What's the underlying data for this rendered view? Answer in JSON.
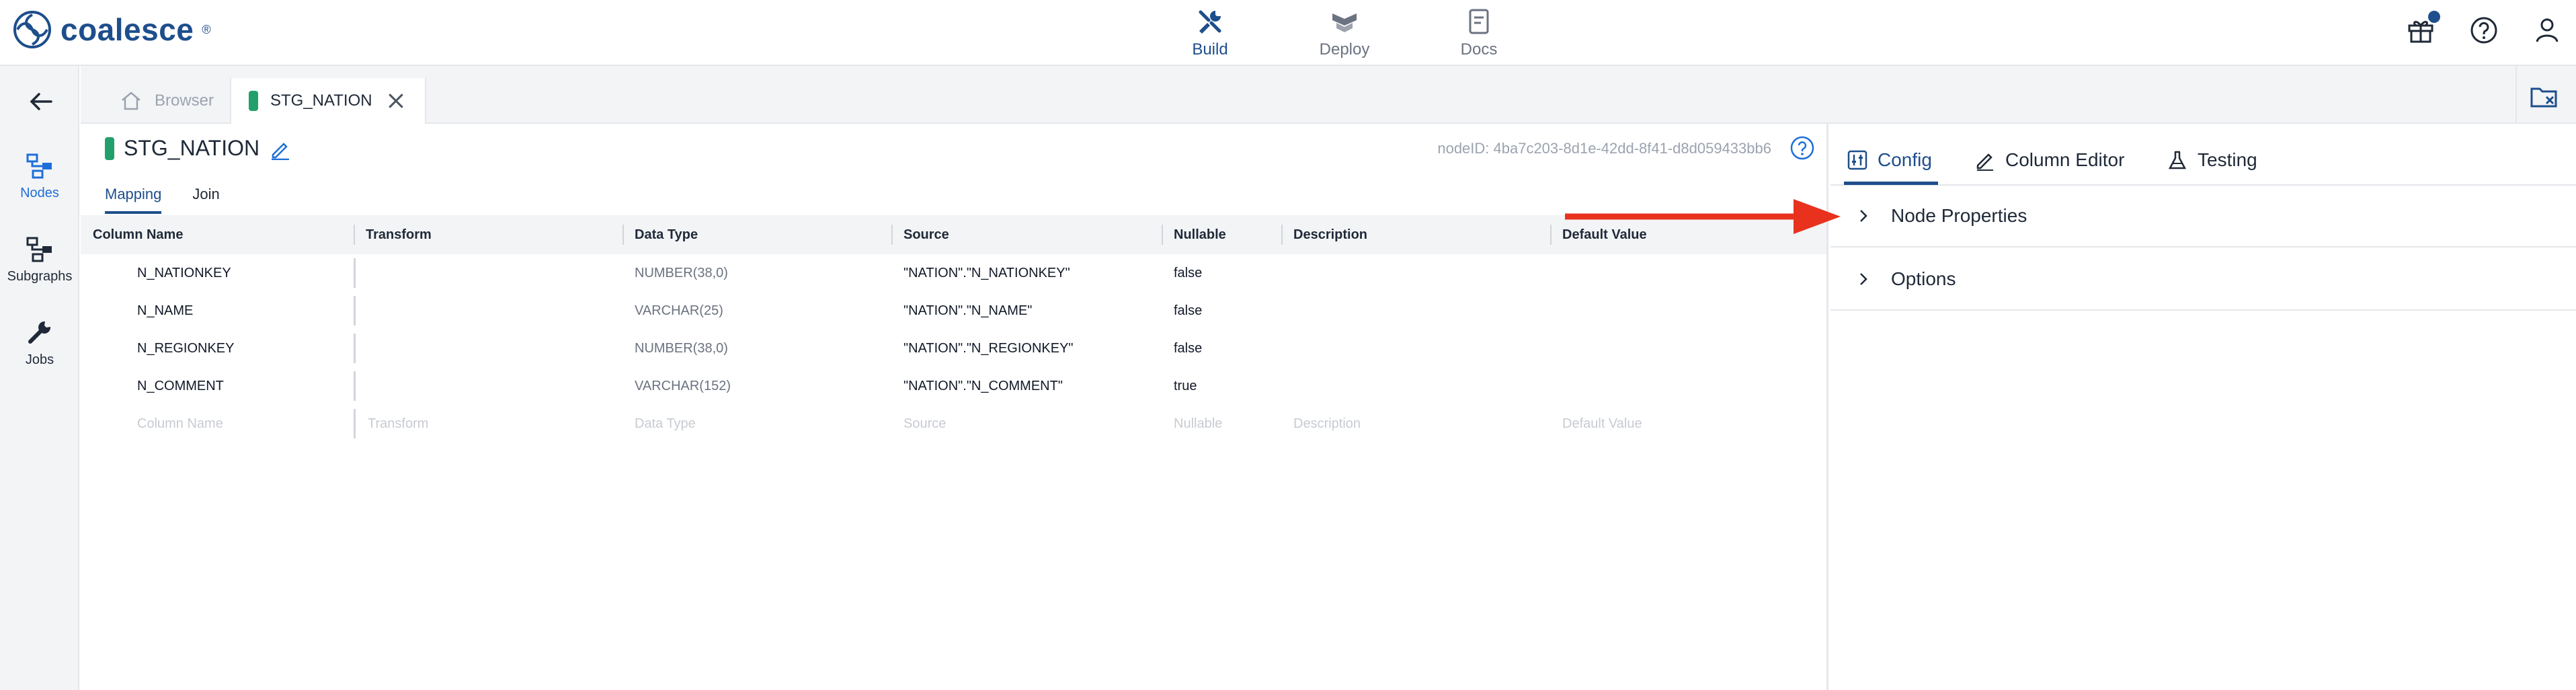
{
  "brand": {
    "name": "coalesce",
    "reg": "®",
    "color": "#1e4e8c"
  },
  "nav": [
    {
      "label": "Build",
      "icon": "tools-icon",
      "active": true
    },
    {
      "label": "Deploy",
      "icon": "deploy-icon",
      "active": false
    },
    {
      "label": "Docs",
      "icon": "docs-icon",
      "active": false
    }
  ],
  "topright": {
    "icons": [
      "gift-icon",
      "help-icon",
      "user-icon"
    ]
  },
  "rail": {
    "items": [
      {
        "label": "Nodes",
        "icon": "nodes-icon",
        "active": true
      },
      {
        "label": "Subgraphs",
        "icon": "subgraphs-icon",
        "active": false
      },
      {
        "label": "Jobs",
        "icon": "wrench-icon",
        "active": false
      }
    ]
  },
  "tabs": {
    "browser": "Browser",
    "active": "STG_NATION"
  },
  "node": {
    "name": "STG_NATION",
    "node_id": "nodeID: 4ba7c203-8d1e-42dd-8f41-d8d059433bb6"
  },
  "subtabs": [
    "Mapping",
    "Join"
  ],
  "grid": {
    "headers": [
      "Column Name",
      "Transform",
      "Data Type",
      "Source",
      "Nullable",
      "Description",
      "Default Value"
    ],
    "rows": [
      [
        "N_NATIONKEY",
        "",
        "NUMBER(38,0)",
        "\"NATION\".\"N_NATIONKEY\"",
        "false",
        "",
        ""
      ],
      [
        "N_NAME",
        "",
        "VARCHAR(25)",
        "\"NATION\".\"N_NAME\"",
        "false",
        "",
        ""
      ],
      [
        "N_REGIONKEY",
        "",
        "NUMBER(38,0)",
        "\"NATION\".\"N_REGIONKEY\"",
        "false",
        "",
        ""
      ],
      [
        "N_COMMENT",
        "",
        "VARCHAR(152)",
        "\"NATION\".\"N_COMMENT\"",
        "true",
        "",
        ""
      ]
    ],
    "placeholder": [
      "Column Name",
      "Transform",
      "Data Type",
      "Source",
      "Nullable",
      "Description",
      "Default Value"
    ]
  },
  "right": {
    "tabs": [
      "Config",
      "Column Editor",
      "Testing"
    ],
    "sections": [
      "Node Properties",
      "Options"
    ]
  },
  "colors": {
    "accent": "#1e4e8c",
    "link": "#1e6fd9",
    "green": "#22a06b",
    "arrow": "#e8321e"
  }
}
